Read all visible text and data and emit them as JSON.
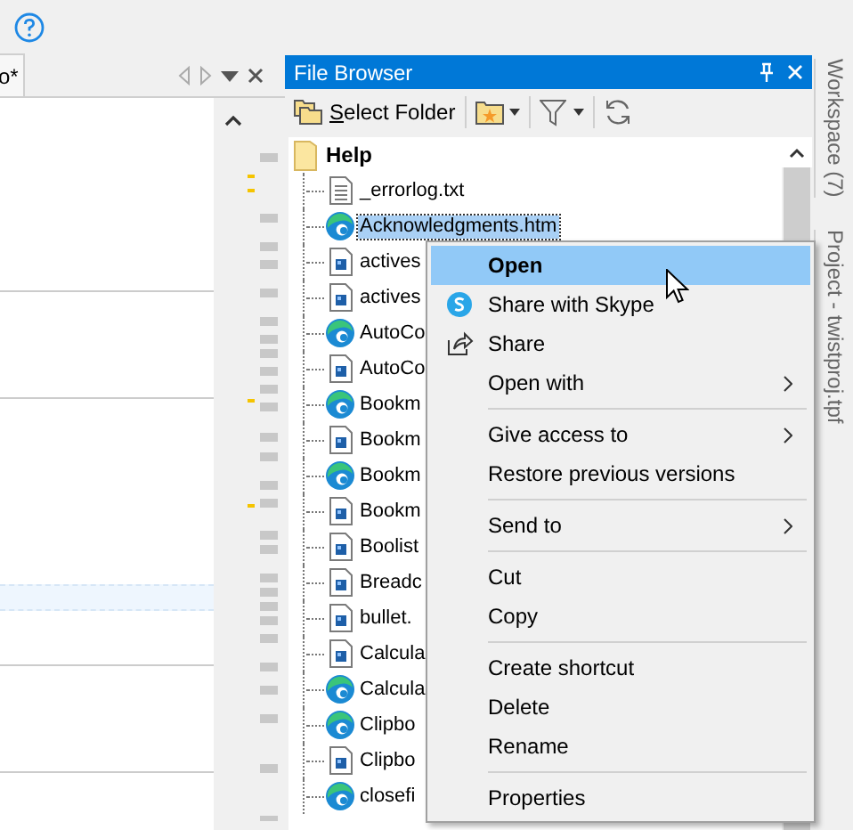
{
  "editor_tab": {
    "label": "o*"
  },
  "file_browser": {
    "title": "File Browser",
    "select_folder": "Select Folder",
    "tree": {
      "label": "Help",
      "children": [
        {
          "label": "_errorlog.txt",
          "kind": "text",
          "selected": false
        },
        {
          "label": "Acknowledgments.htm",
          "kind": "web",
          "selected": true
        },
        {
          "label": "actives",
          "kind": "image",
          "selected": false
        },
        {
          "label": "actives",
          "kind": "image",
          "selected": false
        },
        {
          "label": "AutoCo",
          "kind": "web",
          "selected": false
        },
        {
          "label": "AutoCo",
          "kind": "image",
          "selected": false
        },
        {
          "label": "Bookm",
          "kind": "web",
          "selected": false
        },
        {
          "label": "Bookm",
          "kind": "image",
          "selected": false
        },
        {
          "label": "Bookm",
          "kind": "web",
          "selected": false
        },
        {
          "label": "Bookm",
          "kind": "image",
          "selected": false
        },
        {
          "label": "Boolist",
          "kind": "image",
          "selected": false
        },
        {
          "label": "Breadc",
          "kind": "image",
          "selected": false
        },
        {
          "label": "bullet.",
          "kind": "image",
          "selected": false
        },
        {
          "label": "Calcula",
          "kind": "image",
          "selected": false
        },
        {
          "label": "Calcula",
          "kind": "web",
          "selected": false
        },
        {
          "label": "Clipbo",
          "kind": "web",
          "selected": false
        },
        {
          "label": "Clipbo",
          "kind": "image",
          "selected": false
        },
        {
          "label": "closefi",
          "kind": "web",
          "selected": false
        }
      ]
    }
  },
  "side_tabs": [
    "Workspace (7)",
    "Project - twistproj.tpf"
  ],
  "context_menu": [
    {
      "kind": "item",
      "label": "Open",
      "default": true,
      "selected": true,
      "submenu": false
    },
    {
      "kind": "item",
      "label": "Share with Skype",
      "default": false,
      "selected": false,
      "submenu": false
    },
    {
      "kind": "item",
      "label": "Share",
      "default": false,
      "selected": false,
      "submenu": false
    },
    {
      "kind": "item",
      "label": "Open with",
      "default": false,
      "selected": false,
      "submenu": true
    },
    {
      "kind": "separator"
    },
    {
      "kind": "item",
      "label": "Give access to",
      "default": false,
      "selected": false,
      "submenu": true
    },
    {
      "kind": "item",
      "label": "Restore previous versions",
      "default": false,
      "selected": false,
      "submenu": false
    },
    {
      "kind": "separator"
    },
    {
      "kind": "item",
      "label": "Send to",
      "default": false,
      "selected": false,
      "submenu": true
    },
    {
      "kind": "separator"
    },
    {
      "kind": "item",
      "label": "Cut",
      "default": false,
      "selected": false,
      "submenu": false
    },
    {
      "kind": "item",
      "label": "Copy",
      "default": false,
      "selected": false,
      "submenu": false
    },
    {
      "kind": "separator"
    },
    {
      "kind": "item",
      "label": "Create shortcut",
      "default": false,
      "selected": false,
      "submenu": false
    },
    {
      "kind": "item",
      "label": "Delete",
      "default": false,
      "selected": false,
      "submenu": false
    },
    {
      "kind": "item",
      "label": "Rename",
      "default": false,
      "selected": false,
      "submenu": false
    },
    {
      "kind": "separator"
    },
    {
      "kind": "item",
      "label": "Properties",
      "default": false,
      "selected": false,
      "submenu": false
    }
  ]
}
